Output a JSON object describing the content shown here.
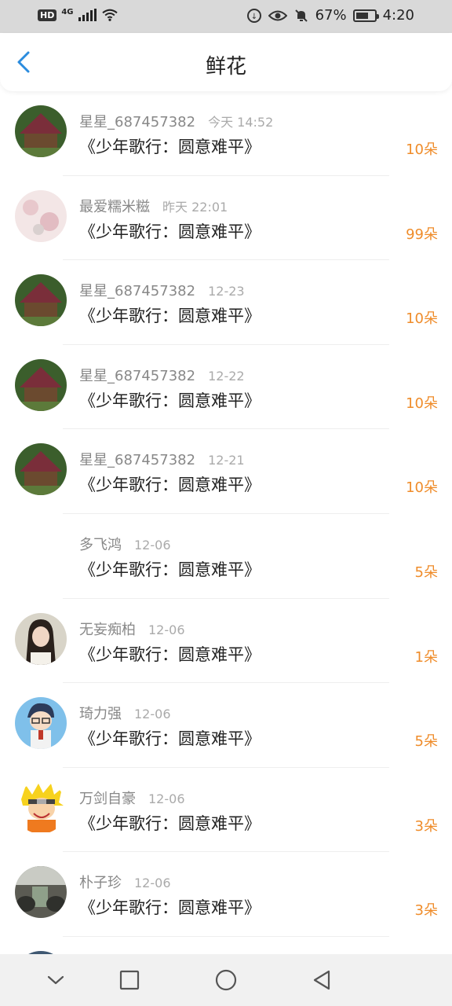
{
  "status_bar": {
    "hd": "HD",
    "net": "4G",
    "battery_percent": "67%",
    "battery_level": 0.67,
    "time": "4:20",
    "icons": [
      "hd-icon",
      "signal-icon",
      "wifi-icon",
      "data-saver-icon",
      "eye-icon",
      "mute-icon",
      "battery-icon"
    ]
  },
  "header": {
    "title": "鲜花",
    "back_icon": "chevron-left-icon",
    "accent_color": "#2b8cde"
  },
  "list": {
    "items": [
      {
        "user": "星星_687457382",
        "time": "今天 14:52",
        "title": "《少年歌行：圆意难平》",
        "amount": "10朵"
      },
      {
        "user": "最爱糯米糍",
        "time": "昨天 22:01",
        "title": "《少年歌行：圆意难平》",
        "amount": "99朵"
      },
      {
        "user": "星星_687457382",
        "time": "12-23",
        "title": "《少年歌行：圆意难平》",
        "amount": "10朵"
      },
      {
        "user": "星星_687457382",
        "time": "12-22",
        "title": "《少年歌行：圆意难平》",
        "amount": "10朵"
      },
      {
        "user": "星星_687457382",
        "time": "12-21",
        "title": "《少年歌行：圆意难平》",
        "amount": "10朵"
      },
      {
        "user": "多飞鸿",
        "time": "12-06",
        "title": "《少年歌行：圆意难平》",
        "amount": "5朵"
      },
      {
        "user": "无妄痴柏",
        "time": "12-06",
        "title": "《少年歌行：圆意难平》",
        "amount": "1朵"
      },
      {
        "user": "琦力强",
        "time": "12-06",
        "title": "《少年歌行：圆意难平》",
        "amount": "5朵"
      },
      {
        "user": "万剑自豪",
        "time": "12-06",
        "title": "《少年歌行：圆意难平》",
        "amount": "3朵"
      },
      {
        "user": "朴子珍",
        "time": "12-06",
        "title": "《少年歌行：圆意难平》",
        "amount": "3朵"
      }
    ],
    "amount_color": "#ef8c2a"
  },
  "nav_bar": {
    "icons": [
      "collapse-icon",
      "recents-icon",
      "home-icon",
      "back-icon"
    ]
  }
}
